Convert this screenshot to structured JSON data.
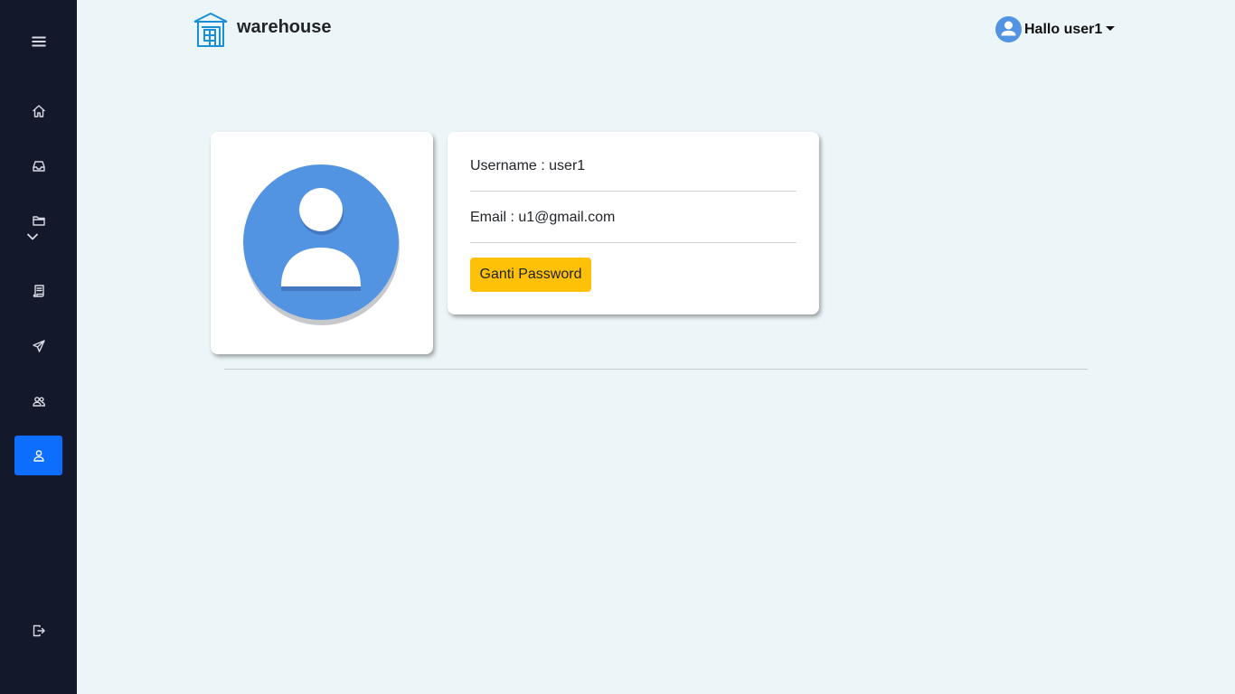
{
  "app": {
    "brand": "warehouse"
  },
  "sidebar": {
    "items": [
      {
        "icon": "menu-icon"
      },
      {
        "icon": "home-icon"
      },
      {
        "icon": "inbox-icon"
      },
      {
        "icon": "folder-icon",
        "expandable": true
      },
      {
        "icon": "receipt-icon"
      },
      {
        "icon": "send-icon"
      },
      {
        "icon": "users-icon"
      },
      {
        "icon": "user-icon",
        "active": true
      },
      {
        "icon": "logout-icon"
      }
    ]
  },
  "header": {
    "greeting": "Hallo user1"
  },
  "profile": {
    "username_text": "Username : user1",
    "email_text": "Email : u1@gmail.com",
    "change_password_label": "Ganti Password"
  },
  "colors": {
    "sidebar_bg": "#13182b",
    "active_item": "#0d6efd",
    "page_bg": "#ecf5f7",
    "avatar_blue": "#5294e2",
    "button_warning": "#ffc107",
    "logo_blue": "#1a8fd8"
  }
}
